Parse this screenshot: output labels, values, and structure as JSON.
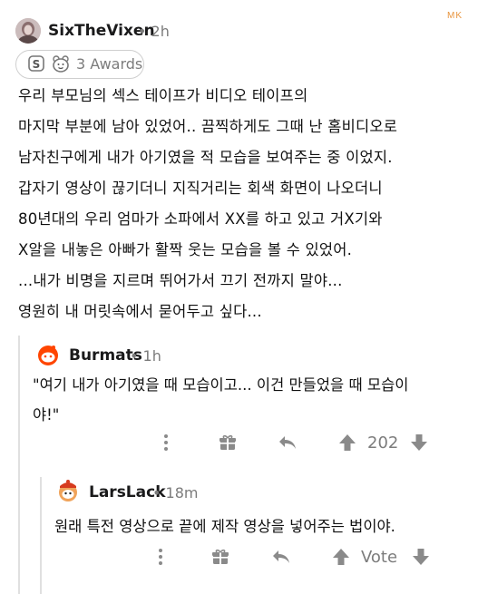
{
  "watermark": "MK",
  "post": {
    "username": "SixTheVixen",
    "time": "• 2h",
    "awards_label": "3 Awards",
    "lines": [
      "우리 부모님의 섹스 테이프가 비디오 테이프의",
      "마지막 부분에 남아 있었어.. 끔찍하게도 그때 난 홈비디오로",
      "남자친구에게 내가 아기였을 적 모습을 보여주는 중 이었지.",
      "갑자기 영상이 끊기더니 지직거리는 회색 화면이 나오더니",
      "80년대의 우리 엄마가 소파에서 XX를 하고 있고 거X기와",
      "X알을 내놓은 아빠가 활짝 웃는 모습을 볼 수 있었어.",
      "...내가 비명을 지르며 뛰어가서 끄기 전까지 말야...",
      "영원히 내 머릿속에서 묻어두고 싶다..."
    ]
  },
  "reply1": {
    "username": "Burmats",
    "time": "• 1h",
    "lines": [
      "\"여기 내가 아기였을 때 모습이고... 이건 만들었을 때 모습이",
      "야!\""
    ],
    "vote_count": "202"
  },
  "reply2": {
    "username": "LarsLack",
    "time": "• 18m",
    "lines": [
      "원래 특전 영상으로 끝에 제작 영상을 넣어주는 법이야."
    ],
    "vote_label": "Vote"
  },
  "colors": {
    "accent": "#ff4500",
    "muted": "#7c7c7c",
    "watermark": "#e8953f"
  }
}
